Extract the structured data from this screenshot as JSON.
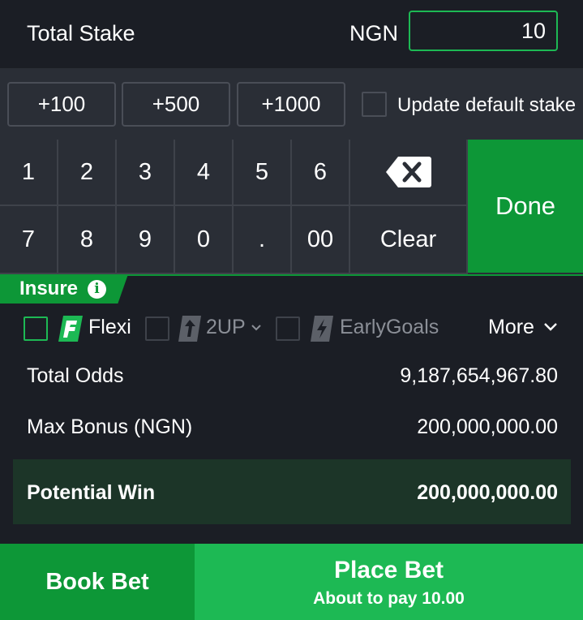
{
  "stake": {
    "label": "Total Stake",
    "currency": "NGN",
    "value": "10"
  },
  "quick_add": [
    {
      "label": "+100"
    },
    {
      "label": "+500"
    },
    {
      "label": "+1000"
    }
  ],
  "update_default": {
    "label": "Update default stake",
    "checked": false
  },
  "keypad": {
    "row1": [
      "1",
      "2",
      "3",
      "4",
      "5",
      "6"
    ],
    "row2": [
      "7",
      "8",
      "9",
      "0",
      ".",
      "00"
    ],
    "backspace_icon": "backspace-icon",
    "clear_label": "Clear",
    "done_label": "Done"
  },
  "insure": {
    "label": "Insure",
    "info_icon": "i"
  },
  "options": {
    "flexi": "Flexi",
    "twoup": "2UP",
    "early_goals": "EarlyGoals",
    "more": "More"
  },
  "summary": {
    "total_odds_label": "Total Odds",
    "total_odds_value": "9,187,654,967.80",
    "max_bonus_label": "Max Bonus (NGN)",
    "max_bonus_value": "200,000,000.00",
    "potential_win_label": "Potential Win",
    "potential_win_value": "200,000,000.00"
  },
  "actions": {
    "book_bet": "Book Bet",
    "place_bet": "Place Bet",
    "place_bet_sub": "About to pay 10.00"
  },
  "colors": {
    "accent": "#1db954",
    "accent_dark": "#0d9737",
    "background": "#1b1e25",
    "panel": "#2a2e36"
  }
}
